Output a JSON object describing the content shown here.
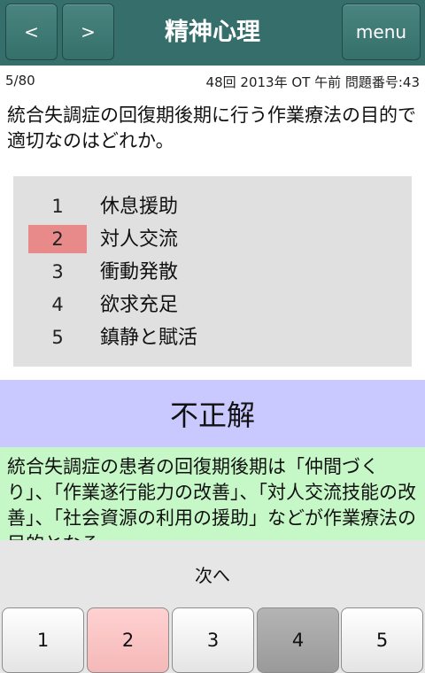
{
  "header": {
    "prev_label": "<",
    "next_label": ">",
    "title": "精神心理",
    "menu_label": "menu"
  },
  "info": {
    "progress": "5/80",
    "meta": "48回 2013年 OT 午前 問題番号:43"
  },
  "question": {
    "text": "統合失調症の回復期後期に行う作業療法の目的で適切なのはどれか。"
  },
  "choices": [
    {
      "num": "1",
      "text": "休息援助"
    },
    {
      "num": "2",
      "text": "対人交流"
    },
    {
      "num": "3",
      "text": "衝動発散"
    },
    {
      "num": "4",
      "text": "欲求充足"
    },
    {
      "num": "5",
      "text": "鎮静と賦活"
    }
  ],
  "selected_choice": "2",
  "correct_choice": "4",
  "result": {
    "text": "不正解"
  },
  "explanation": {
    "text": "統合失調症の患者の回復期後期は「仲間づくり」、「作業遂行能力の改善」、「対人交流技能の改善」、「社会資源の利用の援助」などが作業療法の目的となる。"
  },
  "next_button": {
    "label": "次へ"
  },
  "answer_buttons": [
    "1",
    "2",
    "3",
    "4",
    "5"
  ],
  "colors": {
    "header": "#356e6a",
    "selected": "#e98a8a",
    "result_bg": "#c9c9ff",
    "explain_bg": "#c6f7c6",
    "correct_btn": "#9a9a9a"
  }
}
